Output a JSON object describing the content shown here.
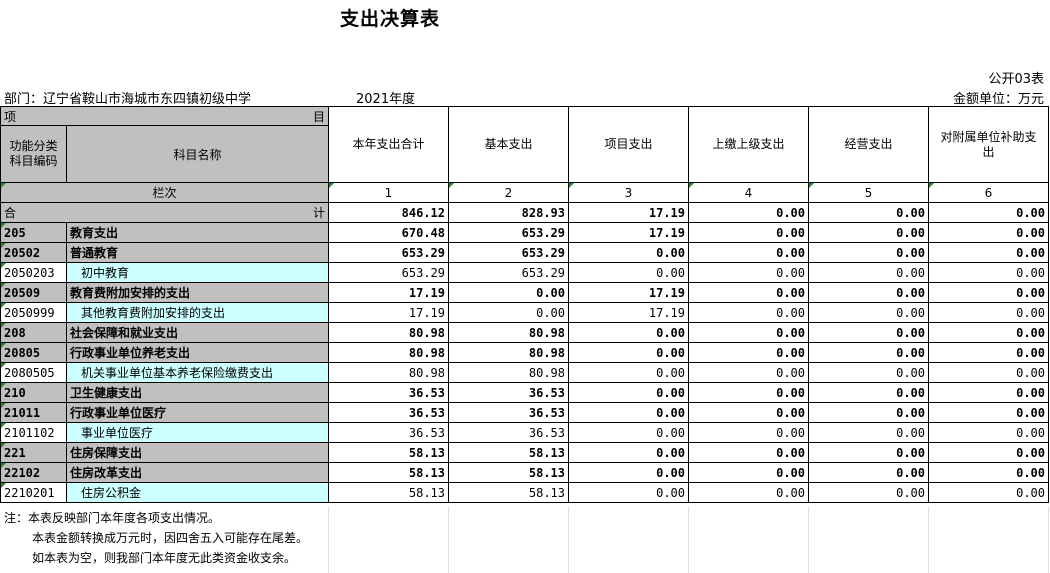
{
  "title": "支出决算表",
  "form_no": "公开03表",
  "department": "部门：辽宁省鞍山市海城市东四镇初级中学",
  "year": "2021年度",
  "unit": "金额单位：万元",
  "headers": {
    "xiang": "项",
    "mu": "目",
    "code": "功能分类科目编码",
    "name": "科目名称",
    "cols": [
      "本年支出合计",
      "基本支出",
      "项目支出",
      "上缴上级支出",
      "经营支出",
      "对附属单位补助支出"
    ],
    "lanci": "栏次",
    "lanci_nums": [
      "1",
      "2",
      "3",
      "4",
      "5",
      "6"
    ]
  },
  "total": {
    "label_left": "合",
    "label_right": "计",
    "values": [
      "846.12",
      "828.93",
      "17.19",
      "0.00",
      "0.00",
      "0.00"
    ]
  },
  "rows": [
    {
      "code": "205",
      "name": "教育支出",
      "level": "bold",
      "values": [
        "670.48",
        "653.29",
        "17.19",
        "0.00",
        "0.00",
        "0.00"
      ]
    },
    {
      "code": "20502",
      "name": "普通教育",
      "level": "bold",
      "values": [
        "653.29",
        "653.29",
        "0.00",
        "0.00",
        "0.00",
        "0.00"
      ]
    },
    {
      "code": "2050203",
      "name": "初中教育",
      "level": "leaf",
      "values": [
        "653.29",
        "653.29",
        "0.00",
        "0.00",
        "0.00",
        "0.00"
      ]
    },
    {
      "code": "20509",
      "name": "教育费附加安排的支出",
      "level": "bold",
      "values": [
        "17.19",
        "0.00",
        "17.19",
        "0.00",
        "0.00",
        "0.00"
      ]
    },
    {
      "code": "2050999",
      "name": "其他教育费附加安排的支出",
      "level": "leaf",
      "values": [
        "17.19",
        "0.00",
        "17.19",
        "0.00",
        "0.00",
        "0.00"
      ]
    },
    {
      "code": "208",
      "name": "社会保障和就业支出",
      "level": "bold",
      "values": [
        "80.98",
        "80.98",
        "0.00",
        "0.00",
        "0.00",
        "0.00"
      ]
    },
    {
      "code": "20805",
      "name": "行政事业单位养老支出",
      "level": "bold",
      "values": [
        "80.98",
        "80.98",
        "0.00",
        "0.00",
        "0.00",
        "0.00"
      ]
    },
    {
      "code": "2080505",
      "name": "机关事业单位基本养老保险缴费支出",
      "level": "leaf",
      "values": [
        "80.98",
        "80.98",
        "0.00",
        "0.00",
        "0.00",
        "0.00"
      ]
    },
    {
      "code": "210",
      "name": "卫生健康支出",
      "level": "bold",
      "values": [
        "36.53",
        "36.53",
        "0.00",
        "0.00",
        "0.00",
        "0.00"
      ]
    },
    {
      "code": "21011",
      "name": "行政事业单位医疗",
      "level": "bold",
      "values": [
        "36.53",
        "36.53",
        "0.00",
        "0.00",
        "0.00",
        "0.00"
      ]
    },
    {
      "code": "2101102",
      "name": "事业单位医疗",
      "level": "leaf",
      "values": [
        "36.53",
        "36.53",
        "0.00",
        "0.00",
        "0.00",
        "0.00"
      ]
    },
    {
      "code": "221",
      "name": "住房保障支出",
      "level": "bold",
      "values": [
        "58.13",
        "58.13",
        "0.00",
        "0.00",
        "0.00",
        "0.00"
      ]
    },
    {
      "code": "22102",
      "name": "住房改革支出",
      "level": "bold",
      "values": [
        "58.13",
        "58.13",
        "0.00",
        "0.00",
        "0.00",
        "0.00"
      ]
    },
    {
      "code": "2210201",
      "name": "住房公积金",
      "level": "leaf",
      "values": [
        "58.13",
        "58.13",
        "0.00",
        "0.00",
        "0.00",
        "0.00"
      ]
    }
  ],
  "notes": [
    "注：本表反映部门本年度各项支出情况。",
    "本表金额转换成万元时，因四舍五入可能存在尾差。",
    "如本表为空，则我部门本年度无此类资金收支余。"
  ],
  "colors": {
    "gray": "#c0c0c0",
    "cyan": "#ccffff",
    "marker": "#1e8a2e"
  }
}
